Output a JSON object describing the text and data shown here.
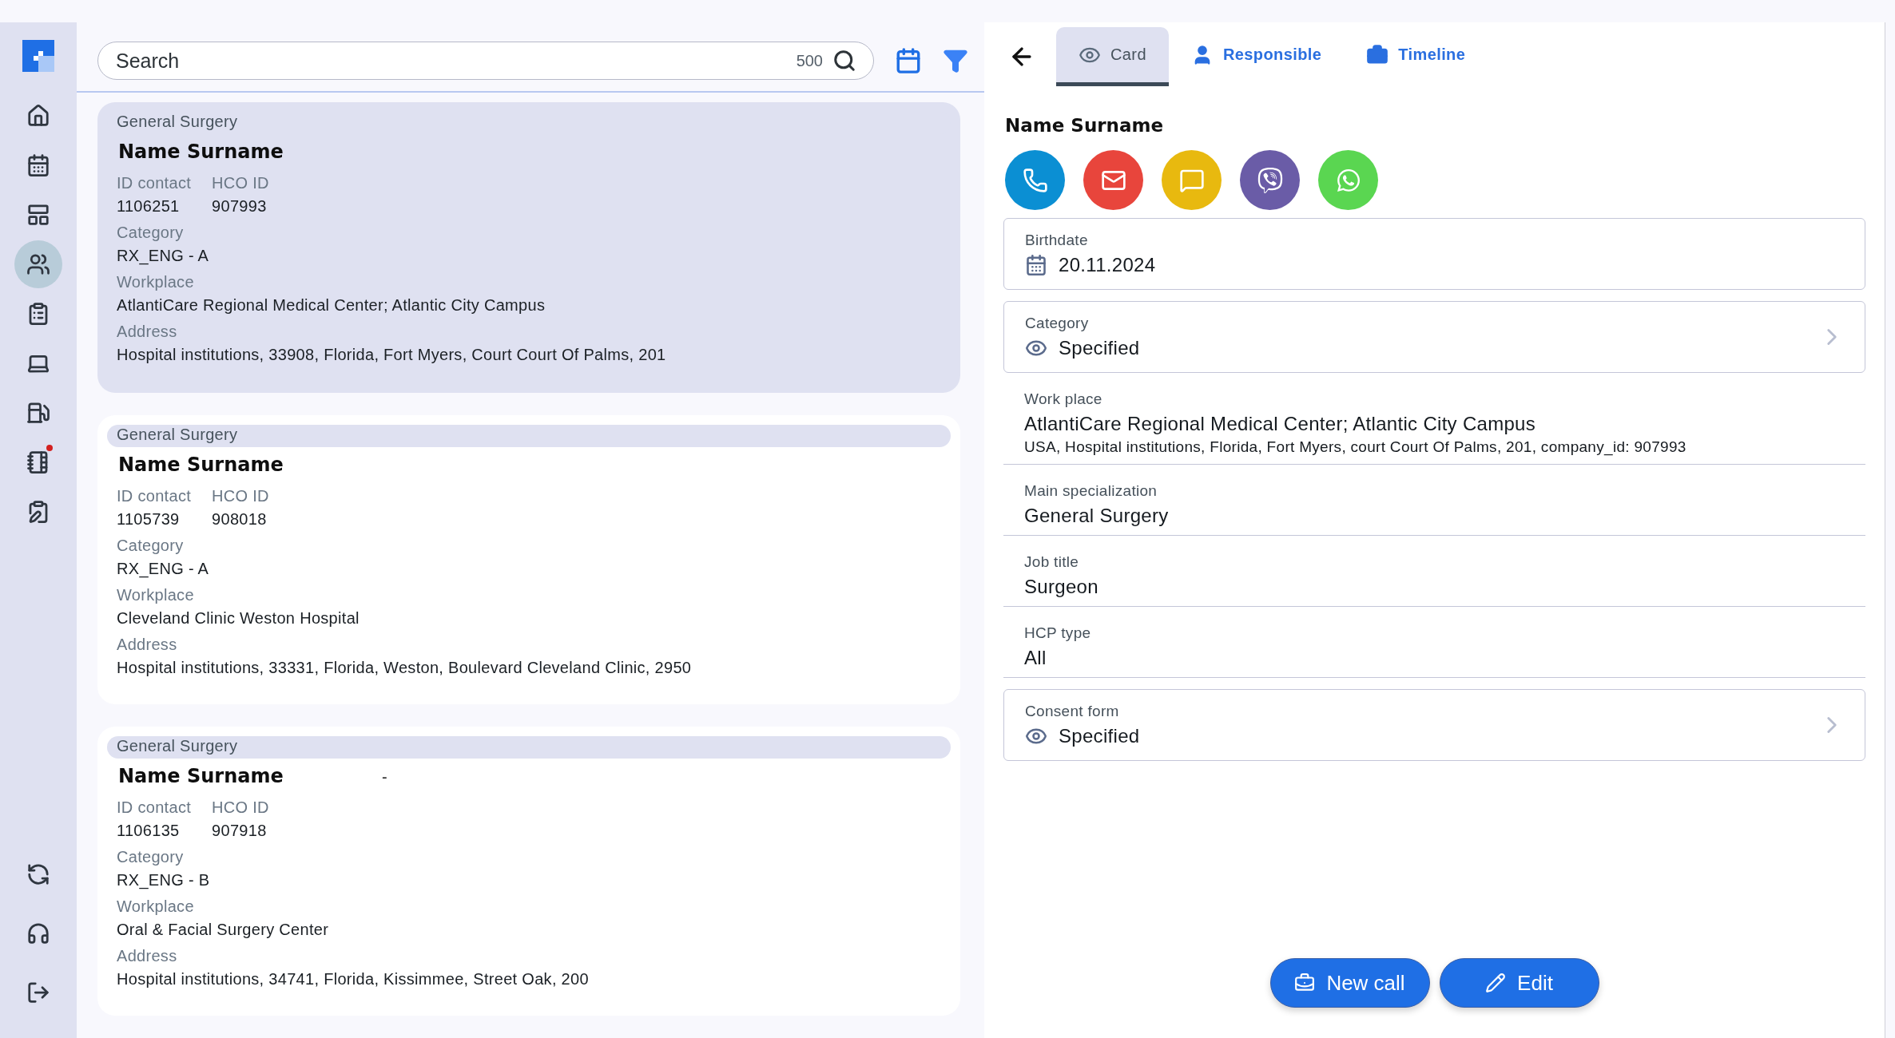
{
  "sidebar": {
    "items": [
      {
        "kind": "home",
        "selected": false,
        "notification": false
      },
      {
        "kind": "calendar",
        "selected": false,
        "notification": false
      },
      {
        "kind": "table",
        "selected": false,
        "notification": false
      },
      {
        "kind": "contacts",
        "selected": true,
        "notification": false
      },
      {
        "kind": "clipboard",
        "selected": false,
        "notification": false
      },
      {
        "kind": "laptop",
        "selected": false,
        "notification": false
      },
      {
        "kind": "fuel",
        "selected": false,
        "notification": false
      },
      {
        "kind": "notebook",
        "selected": false,
        "notification": true
      },
      {
        "kind": "clipboard-pen",
        "selected": false,
        "notification": false
      }
    ],
    "bottom_items": [
      {
        "kind": "sync"
      },
      {
        "kind": "headset"
      },
      {
        "kind": "logout"
      }
    ]
  },
  "search": {
    "placeholder": "Search",
    "count": "500"
  },
  "cards": [
    {
      "selected": true,
      "specialty": "General Surgery",
      "name": "Name Surname",
      "id_label": "ID contact",
      "id": "1106251",
      "hco_label": "HCO ID",
      "hco_id": "907993",
      "category_label": "Category",
      "category": "RX_ENG - A",
      "workplace_label": "Workplace",
      "workplace": "AtlantiCare Regional Medical Center; Atlantic City Campus",
      "address_label": "Address",
      "address": "Hospital institutions, 33908, Florida, Fort Myers, Court Court Of Palms, 201"
    },
    {
      "selected": false,
      "specialty": "General Surgery",
      "name": "Name Surname",
      "id_label": "ID contact",
      "id": "1105739",
      "hco_label": "HCO ID",
      "hco_id": "908018",
      "category_label": "Category",
      "category": "RX_ENG - A",
      "workplace_label": "Workplace",
      "workplace": "Cleveland Clinic Weston Hospital",
      "address_label": "Address",
      "address": "Hospital institutions, 33331, Florida, Weston, Boulevard Cleveland Clinic, 2950"
    },
    {
      "selected": false,
      "specialty": "General Surgery",
      "name": "Name Surname",
      "note": "-",
      "id_label": "ID contact",
      "id": "1106135",
      "hco_label": "HCO ID",
      "hco_id": "907918",
      "category_label": "Category",
      "category": "RX_ENG - B",
      "workplace_label": "Workplace",
      "workplace": "Oral & Facial Surgery Center",
      "address_label": "Address",
      "address": "Hospital institutions, 34741, Florida, Kissimmee, Street Oak, 200"
    }
  ],
  "detail": {
    "tabs": [
      {
        "label": "Card",
        "kind": "card",
        "selected": true
      },
      {
        "label": "Responsible",
        "kind": "person",
        "selected": false
      },
      {
        "label": "Timeline",
        "kind": "timeline",
        "selected": false
      }
    ],
    "name": "Name Surname",
    "contacts": [
      {
        "kind": "phone",
        "color": "#0b8fd3"
      },
      {
        "kind": "email",
        "color": "#e8453c"
      },
      {
        "kind": "sms",
        "color": "#e8b90f"
      },
      {
        "kind": "viber",
        "color": "#6a5ca7"
      },
      {
        "kind": "whatsapp",
        "color": "#5ad651"
      }
    ],
    "fields": [
      {
        "kind": "date",
        "label": "Birthdate",
        "value": "20.11.2024"
      },
      {
        "kind": "link",
        "label": "Category",
        "value": "Specified"
      },
      {
        "kind": "plain",
        "label": "Work place",
        "value": "AtlantiCare Regional Medical Center; Atlantic City Campus",
        "detail": "USA, Hospital institutions, Florida, Fort Myers, court Court Of Palms, 201, company_id: 907993"
      },
      {
        "kind": "plain",
        "label": "Main specialization",
        "value": "General Surgery"
      },
      {
        "kind": "plain",
        "label": "Job title",
        "value": "Surgeon"
      },
      {
        "kind": "plain",
        "label": "HCP type",
        "value": "All"
      },
      {
        "kind": "link",
        "label": "Consent form",
        "value": "Specified"
      }
    ],
    "actions": [
      {
        "kind": "new-call",
        "label": "New call"
      },
      {
        "kind": "edit",
        "label": "Edit"
      }
    ]
  }
}
